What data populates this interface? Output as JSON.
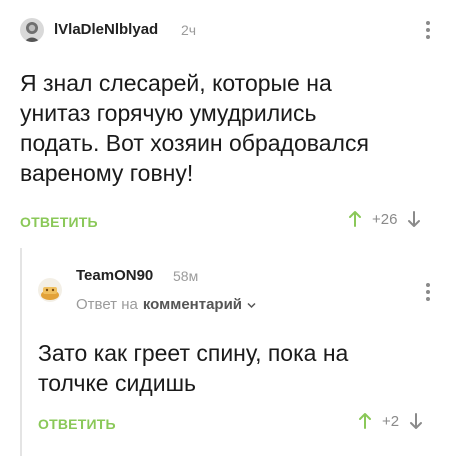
{
  "comment": {
    "author": "lVlaDleNlblyad",
    "time": "2ч",
    "text_lines": [
      "Я знал слесарей, которые на",
      "унитаз горячую умудрились",
      "подать. Вот хозяин обрадовался",
      "вареному говну!"
    ],
    "reply_label": "ОТВЕТИТЬ",
    "rating": "+26"
  },
  "reply": {
    "author": "TeamON90",
    "time": "58м",
    "reply_to_prefix": "Ответ на",
    "reply_to_target": "комментарий",
    "text_lines": [
      "Зато как греет спину, пока на",
      "толчке сидишь"
    ],
    "reply_label": "ОТВЕТИТЬ",
    "rating": "+2"
  },
  "colors": {
    "accent_green": "#8ac858",
    "muted_gray": "#9b9b9b",
    "thread_line": "#e4e4e4"
  },
  "icons": [
    "avatar",
    "more-vert-icon",
    "upvote-arrow-icon",
    "downvote-arrow-icon",
    "chevron-down-icon"
  ]
}
